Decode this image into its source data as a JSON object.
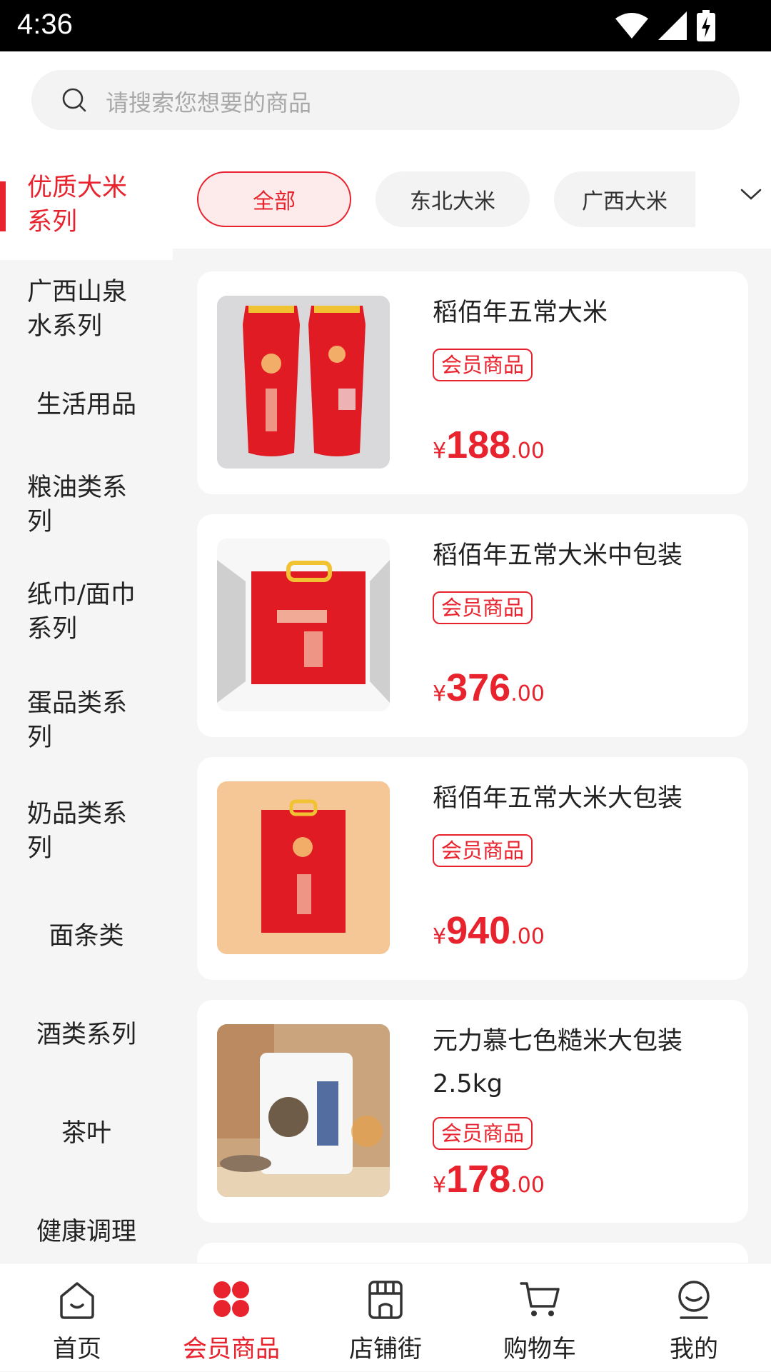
{
  "status_bar": {
    "time": "4:36"
  },
  "search": {
    "placeholder": "请搜索您想要的商品"
  },
  "sidebar": {
    "items": [
      {
        "label": "优质大米系列",
        "active": true
      },
      {
        "label": "广西山泉水系列"
      },
      {
        "label": "生活用品"
      },
      {
        "label": "粮油类系列"
      },
      {
        "label": "纸巾/面巾系列"
      },
      {
        "label": "蛋品类系列"
      },
      {
        "label": "奶品类系列"
      },
      {
        "label": "面条类"
      },
      {
        "label": "酒类系列"
      },
      {
        "label": "茶叶"
      },
      {
        "label": "健康调理"
      }
    ]
  },
  "filters": {
    "chips": [
      {
        "label": "全部",
        "active": true
      },
      {
        "label": "东北大米"
      },
      {
        "label": "广西大米"
      }
    ],
    "expand_icon": "chevron-down-icon"
  },
  "products": [
    {
      "title": "稻佰年五常大米",
      "badge": "会员商品",
      "currency": "¥",
      "price_int": "188",
      "price_dec": ".00"
    },
    {
      "title": "稻佰年五常大米中包装",
      "badge": "会员商品",
      "currency": "¥",
      "price_int": "376",
      "price_dec": ".00"
    },
    {
      "title": "稻佰年五常大米大包装",
      "badge": "会员商品",
      "currency": "¥",
      "price_int": "940",
      "price_dec": ".00"
    },
    {
      "title": "元力慕七色糙米大包装2.5kg",
      "badge": "会员商品",
      "currency": "¥",
      "price_int": "178",
      "price_dec": ".00"
    }
  ],
  "bottom_nav": {
    "items": [
      {
        "label": "首页",
        "icon": "home-icon"
      },
      {
        "label": "会员商品",
        "icon": "member-goods-icon",
        "active": true
      },
      {
        "label": "店铺街",
        "icon": "store-icon"
      },
      {
        "label": "购物车",
        "icon": "cart-icon"
      },
      {
        "label": "我的",
        "icon": "profile-icon"
      }
    ]
  },
  "colors": {
    "accent": "#e8232d",
    "background": "#f5f5f5"
  }
}
